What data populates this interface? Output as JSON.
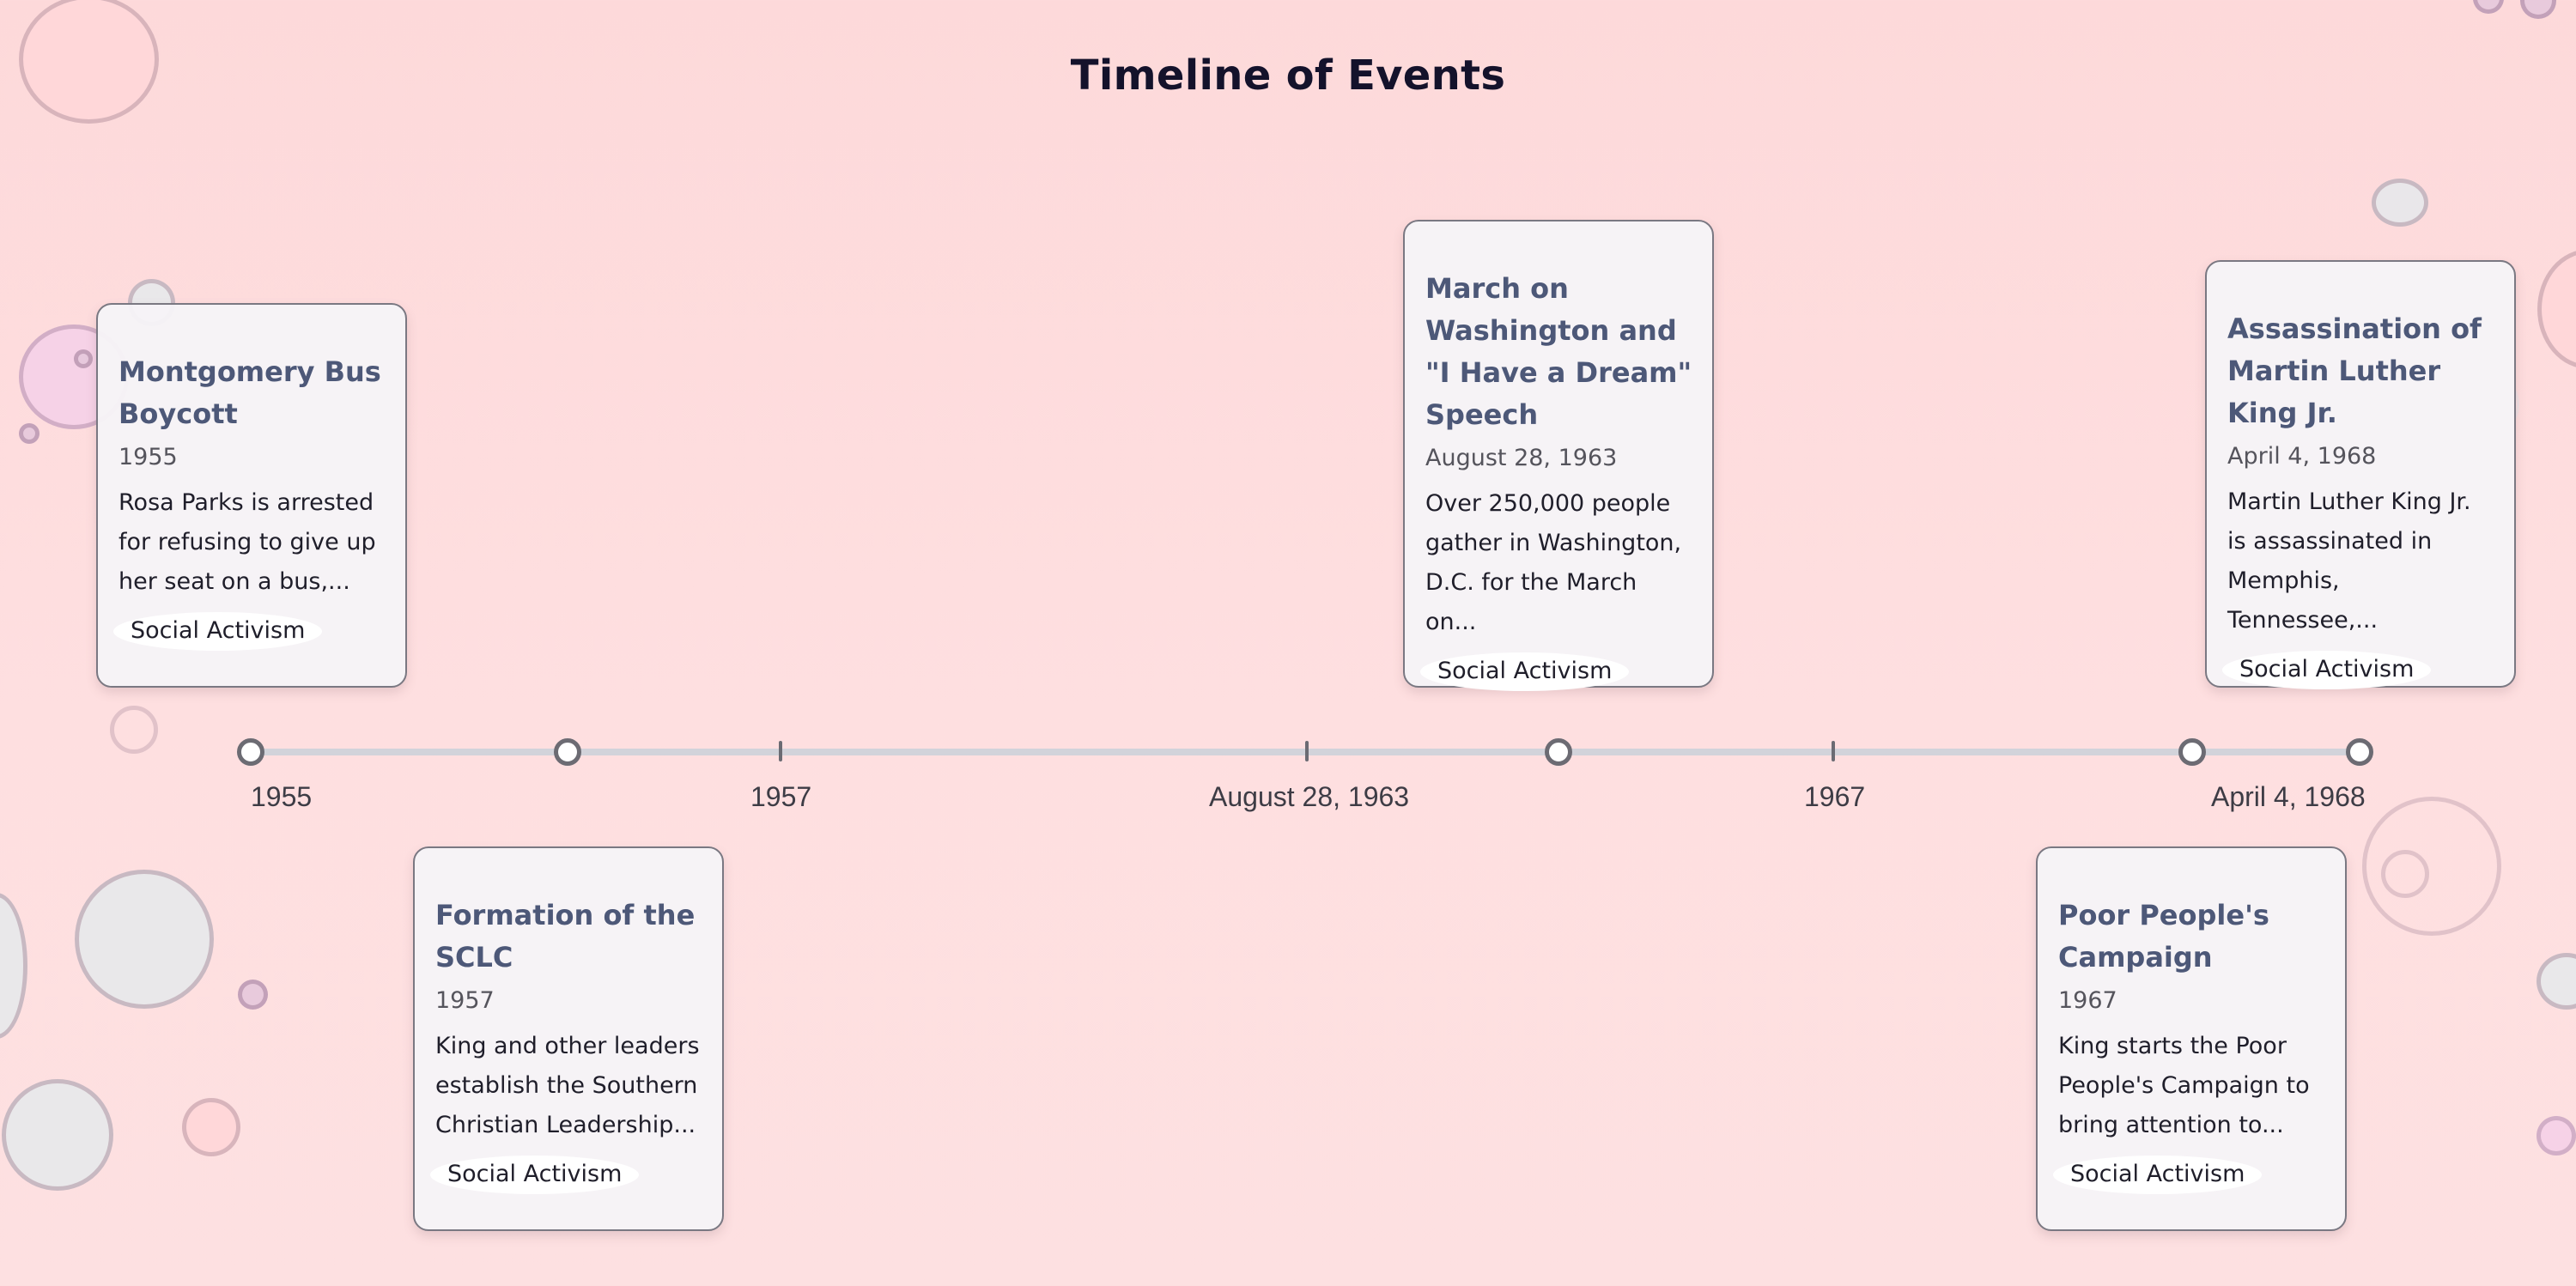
{
  "page": {
    "title": "Timeline of Events"
  },
  "timeline": {
    "axis_labels": [
      "1955",
      "1957",
      "August 28, 1963",
      "1967",
      "April 4, 1968"
    ],
    "events": [
      {
        "title": "Montgomery Bus Boycott",
        "date": "1955",
        "description": "Rosa Parks is arrested for refusing to give up her seat on a bus,...",
        "tag": "Social Activism",
        "position": "above"
      },
      {
        "title": "Formation of the SCLC",
        "date": "1957",
        "description": "King and other leaders establish the Southern Christian Leadership...",
        "tag": "Social Activism",
        "position": "below"
      },
      {
        "title": "March on Washington and \"I Have a Dream\" Speech",
        "date": "August 28, 1963",
        "description": "Over 250,000 people gather in Washington, D.C. for the March on...",
        "tag": "Social Activism",
        "position": "above"
      },
      {
        "title": "Poor People's Campaign",
        "date": "1967",
        "description": "King starts the Poor People's Campaign to bring attention to...",
        "tag": "Social Activism",
        "position": "below"
      },
      {
        "title": "Assassination of Martin Luther King Jr.",
        "date": "April 4, 1968",
        "description": "Martin Luther King Jr. is assassinated in Memphis, Tennessee,...",
        "tag": "Social Activism",
        "position": "above"
      }
    ]
  },
  "colors": {
    "background": "#fdd9da",
    "card_title": "#4d5878",
    "axis_line": "#d2d3da",
    "node_border": "#6c6b73"
  }
}
